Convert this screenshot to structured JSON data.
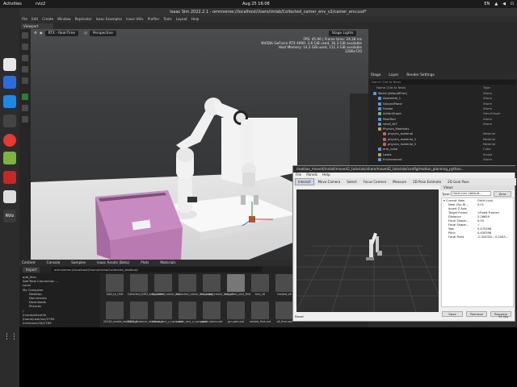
{
  "topbar": {
    "activities": "Activities",
    "app": "rviz2",
    "clock": "Aug 25  16:08",
    "lang": "EN"
  },
  "isaac": {
    "title": "Isaac Sim 2022.2.1 - omniverse://localhost/Users/imlab/Collected_camer_env_v2/camer_env.usd*",
    "menu": [
      "File",
      "Edit",
      "Create",
      "Window",
      "Replicator",
      "Isaac Examples",
      "Isaac Utils",
      "Profiler",
      "Tools",
      "Layout",
      "Help"
    ],
    "viewport_tab": "Viewport",
    "vp_toolbar": {
      "renderer": "RTX - Real-Time",
      "camera": "Perspective",
      "lights": "Stage Lights"
    },
    "stats": [
      "FPS: 45.96 | Frame time: 24.28 ms",
      "NVIDIA GeForce RTX 4090: 3.8 GiB used, 16.3 GiB available",
      "Host Memory: 14.2 GiB used, 111.3 GiB available",
      "1280x720"
    ],
    "box_label": "WAREHOUSE"
  },
  "stage": {
    "tabs": [
      "Stage",
      "Layer",
      "Render Settings"
    ],
    "search": "Name (Old to New)",
    "head_name": "Name (Old to New)",
    "head_type": "Type",
    "rows": [
      {
        "name": "World (defaultPrim)",
        "type": "Xform",
        "indent": 0,
        "color": "#5b9bd5"
      },
      {
        "name": "Assemble_1",
        "type": "Xform",
        "indent": 1,
        "color": "#5b9bd5"
      },
      {
        "name": "GroundPlane",
        "type": "Xform",
        "indent": 1,
        "color": "#5b9bd5"
      },
      {
        "name": "Franka",
        "type": "Xform",
        "indent": 1,
        "color": "#5b9bd5"
      },
      {
        "name": "ActionGraph",
        "type": "OmniGraph",
        "indent": 1,
        "color": "#6ec06e"
      },
      {
        "name": "PoseTool",
        "type": "Xform",
        "indent": 1,
        "color": "#5b9bd5"
      },
      {
        "name": "small_KLT",
        "type": "Xform",
        "indent": 1,
        "color": "#5b9bd5"
      },
      {
        "name": "Physics_Materials",
        "type": "",
        "indent": 1,
        "color": "#c0a050"
      },
      {
        "name": "physics_material",
        "type": "Material",
        "indent": 2,
        "color": "#c06060"
      },
      {
        "name": "physics_material_1",
        "type": "Material",
        "indent": 2,
        "color": "#c06060"
      },
      {
        "name": "physics_material_2",
        "type": "Material",
        "indent": 2,
        "color": "#c06060"
      },
      {
        "name": "arm_cube",
        "type": "Cube",
        "indent": 1,
        "color": "#5b9bd5"
      },
      {
        "name": "Looks",
        "type": "Scope",
        "indent": 1,
        "color": "#c0a050"
      },
      {
        "name": "Environment",
        "type": "Xform",
        "indent": 1,
        "color": "#5b9bd5"
      }
    ],
    "geometry": "Geometry"
  },
  "content": {
    "tabs": [
      "Content",
      "Console",
      "Samples",
      "Isaac Assets (Beta)",
      "Plots",
      "Materials"
    ],
    "import": "Import",
    "path": "omniverse://localhost/Users/imlab/Collected_testbud/",
    "tree": [
      "add_files",
      "Add New Connection ...",
      "Local",
      "My Computer",
      "Desktop",
      "Documents",
      "Downloads",
      "Pictures",
      "/",
      "/nvnas/share/lh",
      "/home/user/src/2790",
      "/mnt/user/18/2789"
    ],
    "items": [
      {
        "label": "SAD_to_USD",
        "dark": false
      },
      {
        "label": "Collected_DIR3_look_nobile",
        "dark": false
      },
      {
        "label": "Collected_camer_env",
        "dark": false
      },
      {
        "label": "Collected_camer_env_vuppr",
        "dark": false
      },
      {
        "label": "Collected_camer_env_v2",
        "dark": false
      },
      {
        "label": "Collected_nect_find",
        "dark": true
      },
      {
        "label": "test_v8",
        "dark": false
      },
      {
        "label": "testbid_v8",
        "dark": false
      },
      {
        "label": "20140_model_mobile.usd",
        "dark": false
      },
      {
        "label": "1469_Instance_nobile.usd",
        "dark": false
      },
      {
        "label": "camer_env_v_nyns.usd",
        "dark": false
      },
      {
        "label": "camer_env_v_nyns.usd",
        "dark": false
      },
      {
        "label": "green plane.usd",
        "dark": false
      },
      {
        "label": "grn-pee.usd",
        "dark": false
      },
      {
        "label": "nested_find.usd",
        "dark": false
      },
      {
        "label": "v8_find.usd",
        "dark": false
      }
    ]
  },
  "rviz": {
    "title": "/root/ws_moveit/install/moveit2_tutorials/share/moveit2_tutorials/config/motion_planning_python...",
    "menu": [
      "File",
      "Panels",
      "Help"
    ],
    "tools": [
      "Interact",
      "Move Camera",
      "Select",
      "Focus Camera",
      "Measure",
      "2D Pose Estimate",
      "2D Goal Pose"
    ],
    "views_title": "Views",
    "type_label": "Type:",
    "type_value": "Orbit (rviz (default...",
    "zero": "Zero",
    "props": [
      {
        "k": "Current View",
        "v": "Orbit (rviz)"
      },
      {
        "k": "Near Clip Di...",
        "v": "0.01"
      },
      {
        "k": "Invert Z Axis",
        "v": ""
      },
      {
        "k": "Target Frame",
        "v": "<Fixed Frame>"
      },
      {
        "k": "Distance",
        "v": "2.26659"
      },
      {
        "k": "Focal Shape...",
        "v": "0.05"
      },
      {
        "k": "Focal Shape...",
        "v": "✓"
      },
      {
        "k": "Yaw",
        "v": "0.470398"
      },
      {
        "k": "Pitch",
        "v": "0.450398"
      },
      {
        "k": "Focal Point",
        "v": "-0.324332; -0.2443..."
      }
    ],
    "save": "Save",
    "remove": "Remove",
    "rename": "Rename",
    "reset": "Reset",
    "fps": "31 fps"
  }
}
